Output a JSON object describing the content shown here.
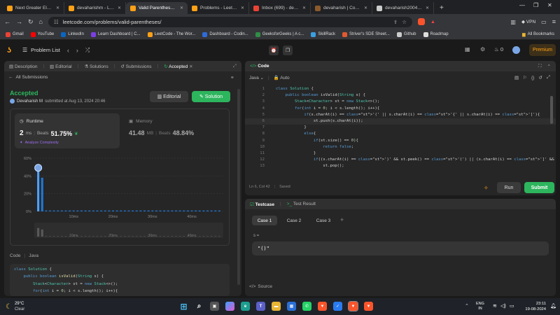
{
  "browser": {
    "tabs": [
      {
        "title": "Next Greater Element I",
        "icon": "leetcode",
        "active": false
      },
      {
        "title": "devaharishm - LeetCode",
        "icon": "leetcode",
        "active": false
      },
      {
        "title": "Valid Parentheses -",
        "icon": "leetcode",
        "active": true
      },
      {
        "title": "Problems - LeetCode",
        "icon": "leetcode",
        "active": false
      },
      {
        "title": "Inbox (699) - devaharish",
        "icon": "gmail",
        "active": false
      },
      {
        "title": "devaharish | CodeChef",
        "icon": "codechef",
        "active": false
      },
      {
        "title": "devaharish2004 (Devah",
        "icon": "github",
        "active": false
      }
    ],
    "new_tab": "+",
    "url": "leetcode.com/problems/valid-parentheses/",
    "vpn": "VPN",
    "bookmarks": [
      {
        "label": "Gmail",
        "color": "#ea4335"
      },
      {
        "label": "YouTube",
        "color": "#ff0000"
      },
      {
        "label": "LinkedIn",
        "color": "#0a66c2"
      },
      {
        "label": "Learn Dashboard | C...",
        "color": "#7b3fe4"
      },
      {
        "label": "LeetCode - The Wor...",
        "color": "#ffa116"
      },
      {
        "label": "Dashboard - Codin...",
        "color": "#2f6bd8"
      },
      {
        "label": "GeeksforGeeks | A c...",
        "color": "#2f8d46"
      },
      {
        "label": "SkillRack",
        "color": "#3aa0e0"
      },
      {
        "label": "Striver's SDE Sheet...",
        "color": "#e05a2f"
      },
      {
        "label": "Github",
        "color": "#cccccc"
      },
      {
        "label": "Roadmap",
        "color": "#dddddd"
      }
    ],
    "all_bookmarks": "All Bookmarks"
  },
  "lc_header": {
    "problem_list": "Problem List",
    "coins": "0",
    "premium": "Premium"
  },
  "left": {
    "tabs": [
      "Description",
      "Editorial",
      "Solutions",
      "Submissions",
      "Accepted"
    ],
    "back": "All Submissions",
    "status": "Accepted",
    "user": "Devaharish M",
    "submitted": "submitted at Aug 13, 2024 20:46",
    "editorial_btn": "Editorial",
    "solution_btn": "Solution",
    "runtime_label": "Runtime",
    "runtime_value": "2",
    "runtime_unit": "ms",
    "beats_label": "Beats",
    "beats_value": "51.75%",
    "analyze": "Analyze Complexity",
    "memory_label": "Memory",
    "memory_value": "41.48",
    "memory_unit": "MB",
    "memory_beats_label": "Beats",
    "memory_beats_value": "48.84%",
    "code_label": "Code",
    "code_lang": "Java",
    "code_lines": [
      "class Solution {",
      "    public boolean isValid(String s) {",
      "        Stack<Character> st = new Stack<>();",
      "        for(int i = 0; i < s.length(); i++){"
    ]
  },
  "chart_data": {
    "type": "bar",
    "yticks": [
      "60%",
      "40%",
      "20%",
      "0%"
    ],
    "ylim": [
      0,
      60
    ],
    "xticks": [
      "10ms",
      "20ms",
      "30ms",
      "40ms"
    ],
    "xlim": [
      0,
      48
    ],
    "bars": [
      {
        "x": 1,
        "y": 46,
        "highlight": true
      },
      {
        "x": 2,
        "y": 38,
        "highlight": false
      },
      {
        "x": 3,
        "y": 1,
        "highlight": false
      },
      {
        "x": 4,
        "y": 1,
        "highlight": false
      },
      {
        "x": 5,
        "y": 1,
        "highlight": false
      },
      {
        "x": 6,
        "y": 1,
        "highlight": false
      },
      {
        "x": 7,
        "y": 1,
        "highlight": false
      },
      {
        "x": 8,
        "y": 1,
        "highlight": false
      },
      {
        "x": 9,
        "y": 1,
        "highlight": false
      },
      {
        "x": 10,
        "y": 1,
        "highlight": false
      },
      {
        "x": 11,
        "y": 1,
        "highlight": false
      },
      {
        "x": 12,
        "y": 1,
        "highlight": false
      },
      {
        "x": 13,
        "y": 1,
        "highlight": false
      },
      {
        "x": 14,
        "y": 1,
        "highlight": false
      },
      {
        "x": 15,
        "y": 1,
        "highlight": false
      },
      {
        "x": 16,
        "y": 1,
        "highlight": false
      },
      {
        "x": 17,
        "y": 1,
        "highlight": false
      },
      {
        "x": 18,
        "y": 1,
        "highlight": false
      },
      {
        "x": 19,
        "y": 1,
        "highlight": false
      },
      {
        "x": 20,
        "y": 1,
        "highlight": false
      },
      {
        "x": 21,
        "y": 1,
        "highlight": false
      },
      {
        "x": 22,
        "y": 1,
        "highlight": false
      },
      {
        "x": 23,
        "y": 1,
        "highlight": false
      },
      {
        "x": 24,
        "y": 1,
        "highlight": false
      },
      {
        "x": 25,
        "y": 1,
        "highlight": false
      },
      {
        "x": 26,
        "y": 1,
        "highlight": false
      },
      {
        "x": 27,
        "y": 1,
        "highlight": false
      },
      {
        "x": 28,
        "y": 1,
        "highlight": false
      },
      {
        "x": 29,
        "y": 1,
        "highlight": false
      },
      {
        "x": 30,
        "y": 1,
        "highlight": false
      },
      {
        "x": 31,
        "y": 1,
        "highlight": false
      },
      {
        "x": 32,
        "y": 1,
        "highlight": false
      },
      {
        "x": 33,
        "y": 1,
        "highlight": false
      },
      {
        "x": 34,
        "y": 1,
        "highlight": false
      },
      {
        "x": 35,
        "y": 1,
        "highlight": false
      },
      {
        "x": 36,
        "y": 1,
        "highlight": false
      },
      {
        "x": 37,
        "y": 1,
        "highlight": false
      },
      {
        "x": 38,
        "y": 1,
        "highlight": false
      },
      {
        "x": 39,
        "y": 1,
        "highlight": false
      },
      {
        "x": 40,
        "y": 1,
        "highlight": false
      },
      {
        "x": 41,
        "y": 1,
        "highlight": false
      },
      {
        "x": 42,
        "y": 1,
        "highlight": false
      },
      {
        "x": 43,
        "y": 1,
        "highlight": false
      },
      {
        "x": 44,
        "y": 1,
        "highlight": false
      },
      {
        "x": 45,
        "y": 1,
        "highlight": false
      },
      {
        "x": 46,
        "y": 1,
        "highlight": false
      },
      {
        "x": 47,
        "y": 1,
        "highlight": false
      }
    ],
    "colors": {
      "bar": "#1e78d6",
      "highlight": "#4ea1ff"
    }
  },
  "editor": {
    "title": "Code",
    "lang": "Java",
    "auto": "Auto",
    "lines": [
      {
        "n": "1",
        "t": "class Solution {"
      },
      {
        "n": "2",
        "t": "    public boolean isValid(String s) {"
      },
      {
        "n": "3",
        "t": "        Stack<Character> st = new Stack<>();"
      },
      {
        "n": "4",
        "t": "        for(int i = 0; i < s.length(); i++){"
      },
      {
        "n": "5",
        "t": "            if(s.charAt(i) == '(' || s.charAt(i) == '{' || s.charAt(i) == '['){"
      },
      {
        "n": "6",
        "t": "                st.push(s.charAt(i));"
      },
      {
        "n": "7",
        "t": "            }"
      },
      {
        "n": "8",
        "t": "            else{"
      },
      {
        "n": "9",
        "t": "                if(st.size() == 0){"
      },
      {
        "n": "10",
        "t": "                    return false;"
      },
      {
        "n": "11",
        "t": "                }"
      },
      {
        "n": "12",
        "t": "                if((s.charAt(i) == ')' && st.peek() == '(') || (s.charAt(i) == ']' && st.peek() == '[') || (s.c"
      },
      {
        "n": "13",
        "t": "                    st.pop();"
      }
    ],
    "status": "Ln 6, Col 42",
    "saved": "Saved",
    "run": "Run",
    "submit": "Submit"
  },
  "testpanel": {
    "tab_testcase": "Testcase",
    "tab_result": "Test Result",
    "cases": [
      "Case 1",
      "Case 2",
      "Case 3"
    ],
    "add": "+",
    "var_label": "s =",
    "var_value": "\"()\"",
    "source": "Source"
  },
  "taskbar": {
    "temp": "29°C",
    "weather": "Clear",
    "lang1": "ENG",
    "lang2": "IN",
    "time": "23:11",
    "date": "19-08-2024"
  }
}
